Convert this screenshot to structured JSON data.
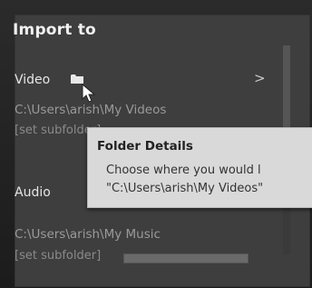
{
  "panel": {
    "title": "Import to"
  },
  "video": {
    "label": "Video",
    "path": "C:\\Users\\arish\\My Videos",
    "subfolder": "[set subfolder]"
  },
  "audio": {
    "label": "Audio",
    "path": "C:\\Users\\arish\\My Music",
    "subfolder": "[set subfolder]"
  },
  "tooltip": {
    "title": "Folder Details",
    "line1": "Choose where you would l",
    "line2": "\"C:\\Users\\arish\\My Videos\""
  },
  "chevron": ">",
  "icons": {
    "folder": "folder-icon",
    "cursor": "cursor-arrow-icon"
  },
  "colors": {
    "panel_bg": "#3e3e3e",
    "tooltip_bg": "#d9d9d9",
    "title_text": "#f0f0f0",
    "path_text": "#9a9a9a"
  },
  "progress": {
    "fraction": 0.0
  }
}
